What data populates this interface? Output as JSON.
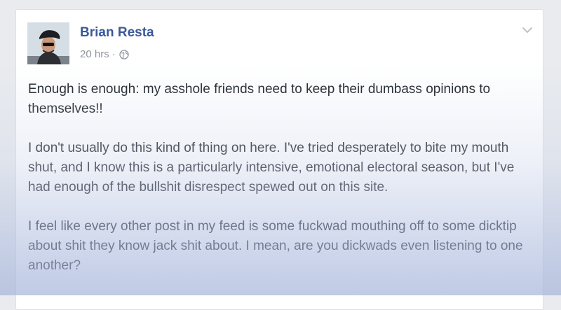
{
  "post": {
    "author": "Brian Resta",
    "timestamp": "20 hrs",
    "separator": "·",
    "privacy_icon": "globe-icon",
    "menu_icon": "chevron-down-icon",
    "paragraphs": [
      "Enough is enough: my asshole friends need to keep their dumbass opinions to themselves!!",
      "I don't usually do this kind of thing on here. I've tried desperately to bite my mouth shut, and I know this is a particularly intensive, emotional electoral season, but I've had enough of the bullshit disrespect spewed out on this site.",
      "I feel like every other post in my feed is some fuckwad mouthing off to some dicktip about shit they know jack shit about. I mean, are you dickwads even listening to one another?"
    ]
  },
  "colors": {
    "author_link": "#3b5998",
    "body_text": "#1d2129",
    "meta_text": "#90949c",
    "background": "#e9ebee"
  }
}
